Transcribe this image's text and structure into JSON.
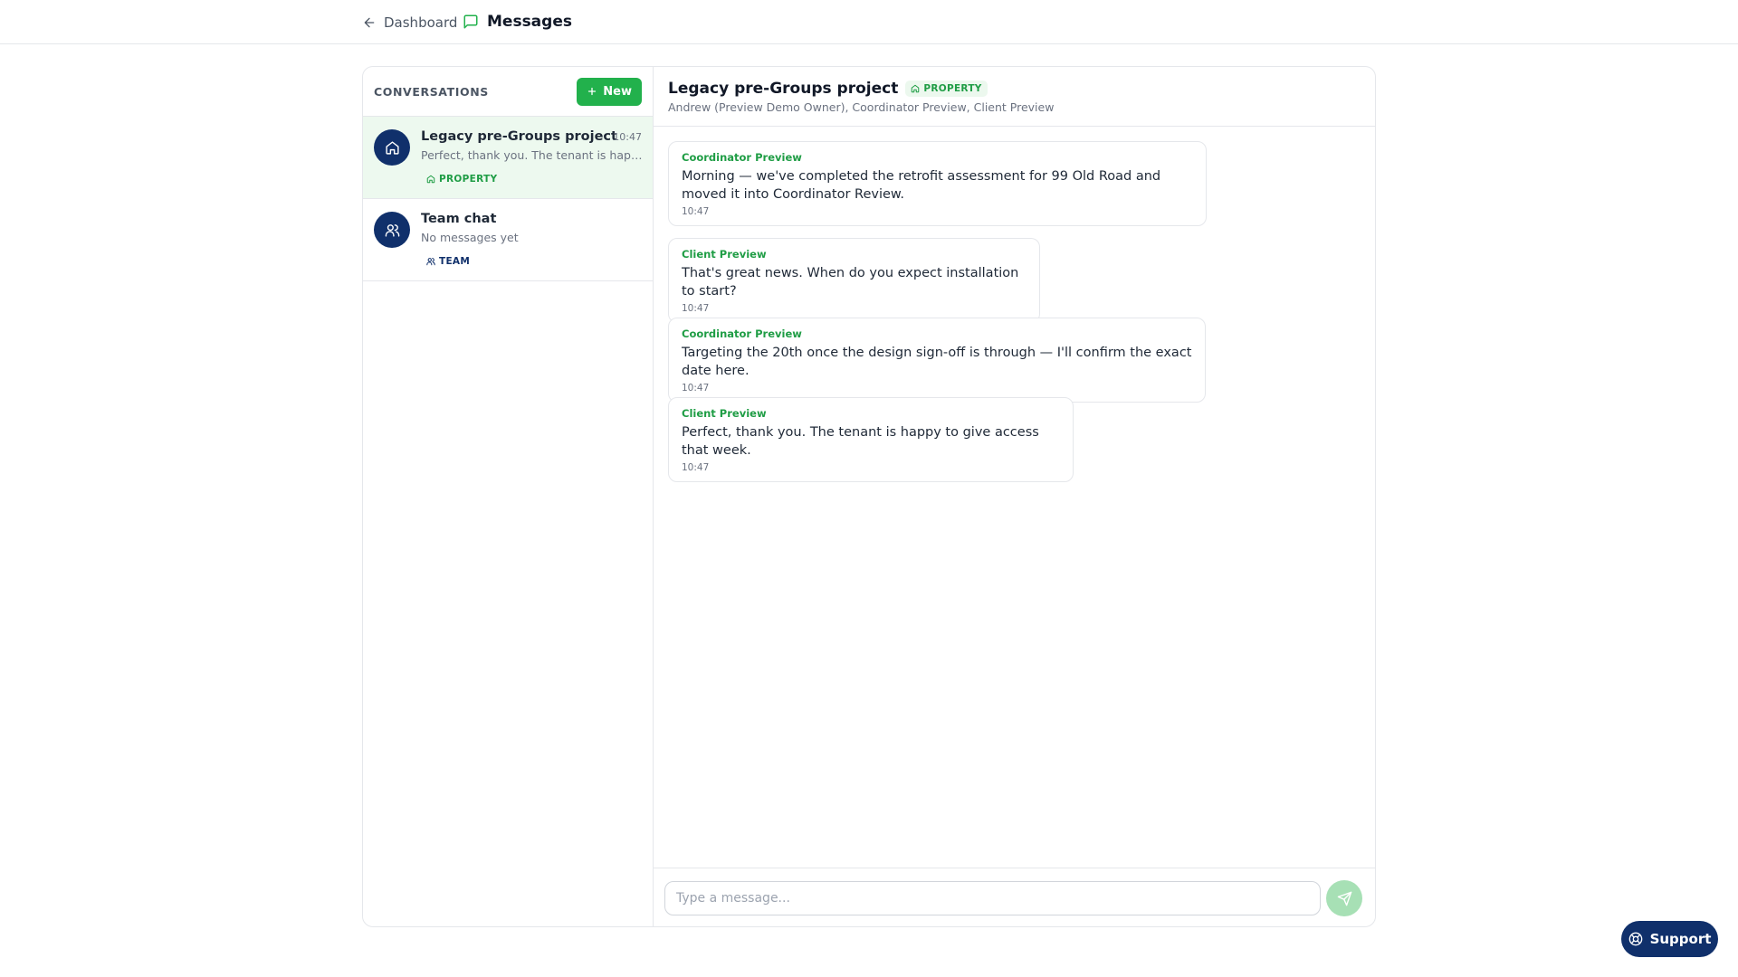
{
  "topbar": {
    "back_label": "Dashboard",
    "title": "Messages"
  },
  "sidebar": {
    "heading": "CONVERSATIONS",
    "new_label": "New",
    "conversations": [
      {
        "name": "Legacy pre-Groups project",
        "time": "10:47",
        "preview": "Perfect, thank you. The tenant is happy to give access that week.",
        "tag": "PROPERTY",
        "tag_icon": "house-icon",
        "avatar_icon": "house-icon",
        "active": true
      },
      {
        "name": "Team chat",
        "time": "",
        "preview": "No messages yet",
        "tag": "TEAM",
        "tag_icon": "users-icon",
        "avatar_icon": "users-icon",
        "active": false
      }
    ]
  },
  "chat": {
    "title": "Legacy pre-Groups project",
    "badge": "PROPERTY",
    "participants": "Andrew (Preview Demo Owner), Coordinator Preview, Client Preview",
    "messages": [
      {
        "sender": "Coordinator Preview",
        "text": "Morning — we've completed the retrofit assessment for 99 Old Road and moved it into Coordinator Review.",
        "time": "10:47"
      },
      {
        "sender": "Client Preview",
        "text": "That's great news. When do you expect installation to start?",
        "time": "10:47"
      },
      {
        "sender": "Coordinator Preview",
        "text": "Targeting the 20th once the design sign-off is through — I'll confirm the exact date here.",
        "time": "10:47"
      },
      {
        "sender": "Client Preview",
        "text": "Perfect, thank you. The tenant is happy to give access that week.",
        "time": "10:47"
      }
    ],
    "composer": {
      "placeholder": "Type a message...",
      "value": ""
    }
  },
  "support": {
    "label": "Support"
  },
  "colors": {
    "accent_green": "#22b14c",
    "navy": "#10306b",
    "active_row": "#edf9ef"
  }
}
